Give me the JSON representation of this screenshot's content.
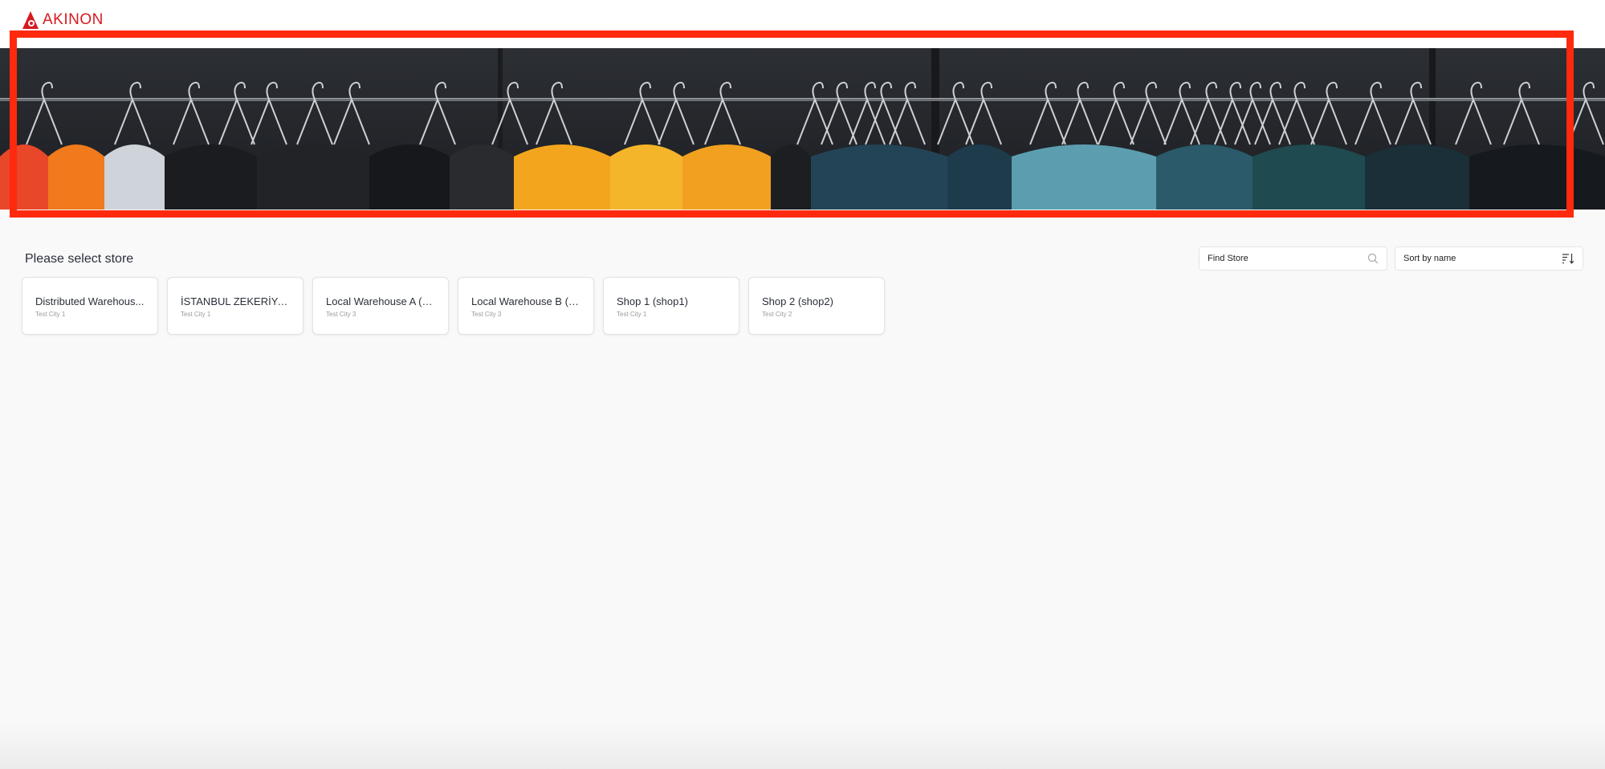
{
  "brand": {
    "logo_text": "AKINON",
    "logo_color": "#d7191f"
  },
  "banner": {
    "image": "clothes-on-hangers-rack",
    "highlight_color": "#ff2a0e"
  },
  "store_section": {
    "title": "Please select store"
  },
  "search": {
    "placeholder": "Find Store",
    "icon": "search-icon"
  },
  "sort": {
    "label": "Sort by name",
    "icon": "sort-icon"
  },
  "stores": [
    {
      "name": "Distributed Warehous...",
      "city": "Test City 1"
    },
    {
      "name": "İSTANBUL ZEKERİYAK...",
      "city": "Test City 1"
    },
    {
      "name": "Local Warehouse A (s...",
      "city": "Test City 3"
    },
    {
      "name": "Local Warehouse B (s...",
      "city": "Test City 3"
    },
    {
      "name": "Shop 1 (shop1)",
      "city": "Test City 1"
    },
    {
      "name": "Shop 2 (shop2)",
      "city": "Test City 2"
    }
  ]
}
